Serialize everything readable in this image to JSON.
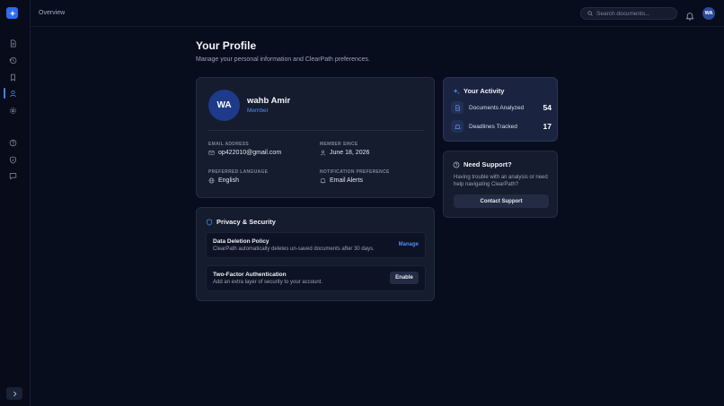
{
  "topbar": {
    "breadcrumb": "Overview",
    "search_placeholder": "Search documents...",
    "avatar_initials": "WA"
  },
  "sidebar": {
    "items": [
      {
        "name": "documents",
        "icon": "document-icon"
      },
      {
        "name": "history",
        "icon": "history-icon"
      },
      {
        "name": "bookmarks",
        "icon": "bookmark-icon"
      },
      {
        "name": "profile",
        "icon": "user-icon",
        "active": true
      },
      {
        "name": "settings",
        "icon": "gear-icon"
      },
      {
        "name": "help",
        "icon": "help-icon"
      },
      {
        "name": "security",
        "icon": "shield-icon"
      },
      {
        "name": "messages",
        "icon": "message-icon"
      }
    ]
  },
  "page": {
    "title": "Your Profile",
    "subtitle": "Manage your personal information and ClearPath preferences."
  },
  "profile": {
    "initials": "WA",
    "name": "wahb Amir",
    "role": "Member",
    "email_label": "EMAIL ADDRESS",
    "email": "op422010@gmail.com",
    "member_since_label": "MEMBER SINCE",
    "member_since": "June 18, 2026",
    "language_label": "PREFERRED LANGUAGE",
    "language": "English",
    "notification_label": "NOTIFICATION PREFERENCE",
    "notification": "Email Alerts"
  },
  "privacy": {
    "title": "Privacy & Security",
    "rows": [
      {
        "title": "Data Deletion Policy",
        "desc": "ClearPath automatically deletes un-saved documents after 30 days.",
        "action": "Manage"
      },
      {
        "title": "Two-Factor Authentication",
        "desc": "Add an extra layer of security to your account.",
        "action": "Enable"
      }
    ]
  },
  "activity": {
    "title": "Your Activity",
    "stats": [
      {
        "label": "Documents Analyzed",
        "value": "54"
      },
      {
        "label": "Deadlines Tracked",
        "value": "17"
      }
    ]
  },
  "support": {
    "title": "Need Support?",
    "text": "Having trouble with an analysis or need help navigating ClearPath?",
    "button": "Contact Support"
  },
  "colors": {
    "background": "#080d1e",
    "card": "#151c2e",
    "accent": "#3b82f6",
    "link": "#4f8bf7"
  }
}
